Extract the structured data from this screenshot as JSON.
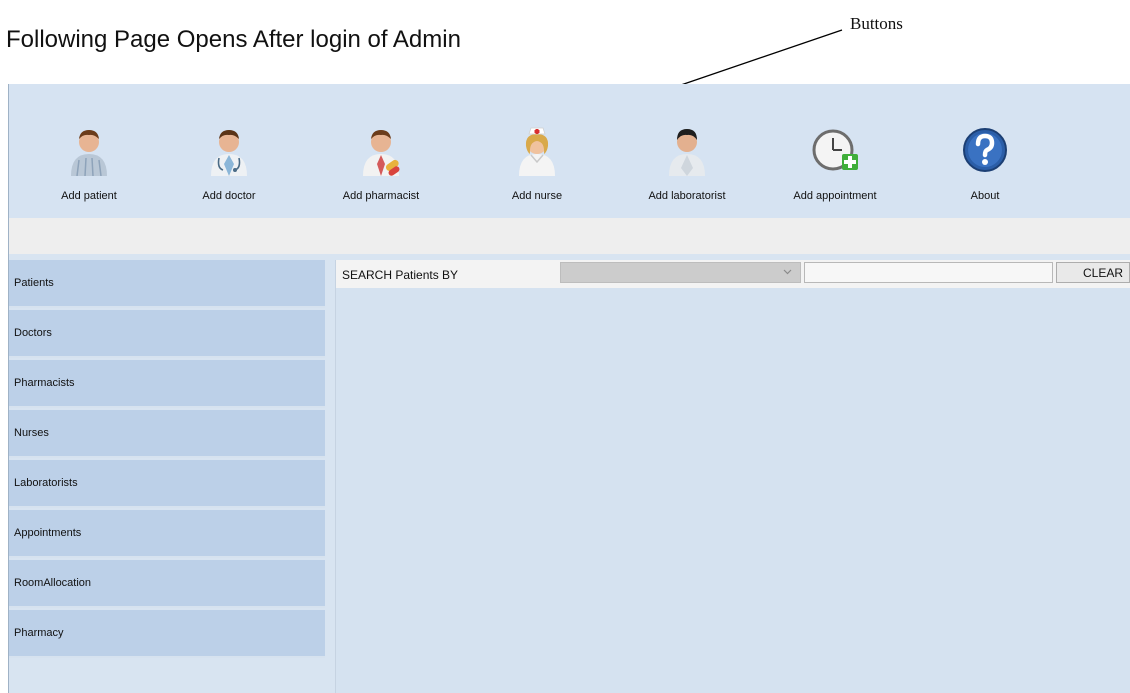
{
  "doc_title": "Following Page Opens After login of Admin",
  "callout_label": "Buttons",
  "toolbar": {
    "buttons": [
      {
        "label": "Add patient",
        "icon": "patient-icon"
      },
      {
        "label": "Add doctor",
        "icon": "doctor-icon"
      },
      {
        "label": "Add pharmacist",
        "icon": "pharmacist-icon"
      },
      {
        "label": "Add nurse",
        "icon": "nurse-icon"
      },
      {
        "label": "Add laboratorist",
        "icon": "laboratorist-icon"
      },
      {
        "label": "Add appointment",
        "icon": "clock-add-icon"
      },
      {
        "label": "About",
        "icon": "help-icon"
      }
    ]
  },
  "sidebar": {
    "items": [
      {
        "label": "Patients"
      },
      {
        "label": "Doctors"
      },
      {
        "label": "Pharmacists"
      },
      {
        "label": "Nurses"
      },
      {
        "label": "Laboratorists"
      },
      {
        "label": "Appointments"
      },
      {
        "label": "RoomAllocation"
      },
      {
        "label": "Pharmacy"
      }
    ]
  },
  "search": {
    "label": "SEARCH Patients BY",
    "selected_value": "",
    "input_value": "",
    "clear_label": "CLEAR"
  },
  "colors": {
    "toolbar_bg": "#d6e3f2",
    "sidebar_item_bg": "#bcd0e8",
    "content_bg": "#d5e2f0"
  }
}
